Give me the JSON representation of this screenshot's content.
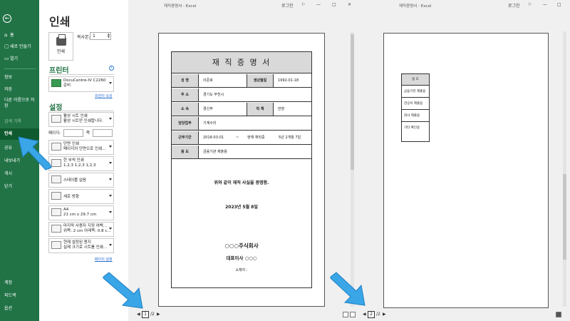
{
  "window": {
    "title_left": "재직증명서 - Excel",
    "title_right": "재직증명서 - Excel",
    "login": "로그인",
    "min": "—",
    "max": "□",
    "close": "✕"
  },
  "sidebar": {
    "back": "←",
    "items": {
      "home": "홈",
      "new": "새로 만들기",
      "open": "열기",
      "info": "정보",
      "save": "저장",
      "saveas": "다른 이름으로 저장",
      "history": "검색 기록",
      "print": "인쇄",
      "share": "공유",
      "export": "내보내기",
      "publish": "게시",
      "close": "닫기",
      "account": "계정",
      "feedback": "피드백",
      "options": "옵션"
    }
  },
  "print": {
    "title": "인쇄",
    "print_button": "인쇄",
    "copies_label": "복사본:",
    "copies_value": "1",
    "printer_heading": "프린터",
    "printer_name": "DocuCentre-IV C2260",
    "printer_status": "준비",
    "printer_props": "프린터 속성",
    "settings_heading": "설정",
    "active_sheet_1": "활성 시트 인쇄",
    "active_sheet_2": "활성 시트만 인쇄합니다.",
    "pages_label": "페이지:",
    "to_label": "쪽",
    "one_sided_1": "단면 인쇄",
    "one_sided_2": "페이지의 단면으로 인쇄...",
    "collated_1": "한 부씩 인쇄",
    "collated_2": "1,2,3    1,2,3    1,2,3",
    "uncollated": "스테이플 없음",
    "orientation": "세로 방향",
    "paper_1": "A4",
    "paper_2": "21 cm x 29.7 cm",
    "margins_1": "마지막 사용자 지정 여백...",
    "margins_2": "위쪽: 2 cm 아래쪽: 0.8 c...",
    "scaling_1": "현재 설정된 용지",
    "scaling_2": "실제 크기로 시트를 인쇄...",
    "page_setup": "페이지 설정"
  },
  "preview": {
    "left": {
      "page_current": "1",
      "page_total": "/2",
      "prev": "◀",
      "next": "▶"
    },
    "right": {
      "page_current": "2",
      "page_total": "/2",
      "prev": "◀",
      "next": "▶"
    }
  },
  "certificate": {
    "title": "재 직 증 명 서",
    "name_label": "성    명",
    "name_value": "이준호",
    "birth_label": "생년월일",
    "birth_value": "1992-01-18",
    "addr_label": "주    소",
    "addr_value": "경기도 부천시",
    "dept_label": "소    속",
    "dept_value": "경신부",
    "rank_label": "직    책",
    "rank_value": "반장",
    "duty_label": "담당업무",
    "duty_value": "기계수리",
    "period_label": "근무기간",
    "period_start": "2018-03-01",
    "period_sep": "~",
    "period_end": "현재 재직중",
    "period_len": "5년 2개월 7일",
    "use_label": "용    도",
    "use_value": "금융기관 제출용",
    "statement": "위와 같이 재직 사실을 증명함.",
    "date": "2023년 5월 8일",
    "company": "○○○주식회사",
    "ceo": "대표이사   ○○○",
    "location": "소재지 :"
  },
  "page2": {
    "header": "용    도",
    "items": [
      "금융기관 제출용",
      "관공서 제출용",
      "회사 제출용",
      "기타 확인용"
    ]
  }
}
